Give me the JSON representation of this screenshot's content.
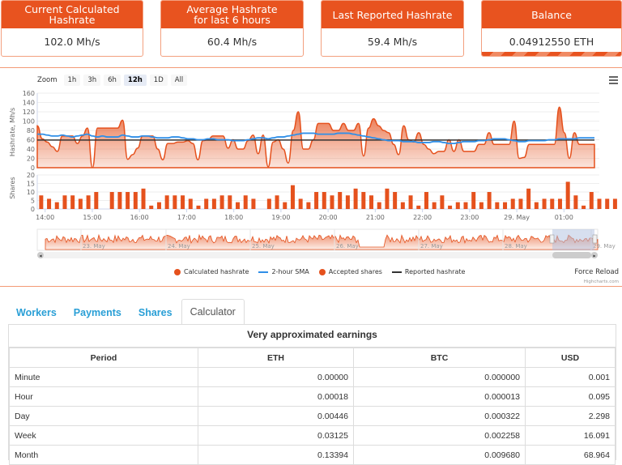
{
  "stats": [
    {
      "title": "Current Calculated Hashrate",
      "value": "102.0 Mh/s"
    },
    {
      "title": "Average Hashrate for last 6 hours",
      "value": "60.4 Mh/s"
    },
    {
      "title": "Last Reported Hashrate",
      "value": "59.4 Mh/s"
    },
    {
      "title": "Balance",
      "value": "0.04912550 ETH"
    }
  ],
  "zoom": {
    "label": "Zoom",
    "buttons": [
      "1h",
      "3h",
      "6h",
      "12h",
      "1D",
      "All"
    ],
    "active": "12h"
  },
  "legend": [
    {
      "label": "Calculated hashrate",
      "color": "#e5511d",
      "kind": "dot"
    },
    {
      "label": "2-hour SMA",
      "color": "#2f8fe8",
      "kind": "line"
    },
    {
      "label": "Accepted shares",
      "color": "#e5511d",
      "kind": "dot"
    },
    {
      "label": "Reported hashrate",
      "color": "#333333",
      "kind": "line"
    }
  ],
  "force_reload": "Force Reload",
  "credits": "Highcharts.com",
  "chart_data": {
    "type": "area",
    "hashrate": {
      "ylabel": "Hashrate, Mh/s",
      "ylim": [
        0,
        160
      ],
      "yticks": [
        0,
        20,
        40,
        60,
        80,
        100,
        120,
        140,
        160
      ],
      "calculated": [
        90,
        62,
        55,
        45,
        35,
        68,
        68,
        68,
        52,
        68,
        85,
        0,
        85,
        85,
        85,
        85,
        85,
        102,
        18,
        28,
        42,
        68,
        68,
        68,
        40,
        17,
        52,
        52,
        55,
        55,
        58,
        52,
        17,
        58,
        60,
        68,
        68,
        68,
        42,
        60,
        40,
        40,
        58,
        70,
        30,
        70,
        2,
        55,
        60,
        40,
        10,
        80,
        120,
        40,
        40,
        60,
        95,
        95,
        95,
        80,
        80,
        95,
        80,
        80,
        95,
        25,
        85,
        105,
        90,
        80,
        75,
        50,
        28,
        90,
        60,
        55,
        75,
        50,
        40,
        30,
        35,
        35,
        60,
        35,
        60,
        35,
        35,
        35,
        50,
        50,
        75,
        50,
        50,
        50,
        50,
        100,
        20,
        22,
        50,
        50,
        50,
        50,
        50,
        50,
        130,
        75,
        20,
        75,
        50,
        50,
        50,
        50
      ],
      "sma": [
        72,
        72,
        70,
        68,
        68,
        70,
        68,
        66,
        68,
        70,
        72,
        68,
        66,
        68,
        66,
        66,
        66,
        70,
        68,
        66,
        66,
        68,
        68,
        66,
        64,
        64,
        64,
        66,
        66,
        64,
        62,
        62,
        60,
        60,
        62,
        62,
        60,
        60,
        60,
        58,
        58,
        58,
        60,
        62,
        64,
        64,
        62,
        64,
        66,
        66,
        68,
        70,
        72,
        74,
        74,
        74,
        72,
        72,
        72,
        72,
        74,
        74,
        74,
        72,
        70,
        68,
        66,
        64,
        62,
        60,
        58,
        58,
        58,
        56,
        56,
        56,
        54,
        54,
        54,
        56,
        56,
        54,
        52,
        52,
        54,
        56,
        56,
        56,
        58,
        58,
        60,
        62,
        62,
        62,
        60,
        58,
        56,
        56,
        58,
        58,
        58,
        58,
        60,
        60,
        62,
        62,
        62,
        62,
        64,
        64,
        64,
        64
      ],
      "reported": 59.4
    },
    "shares": {
      "ylabel": "Shares",
      "ylim": [
        0,
        20
      ],
      "yticks": [
        0,
        5,
        10,
        15,
        20
      ],
      "values": [
        8,
        6,
        4,
        8,
        8,
        6,
        8,
        10,
        0,
        10,
        10,
        10,
        10,
        12,
        2,
        4,
        8,
        8,
        8,
        6,
        2,
        6,
        6,
        8,
        8,
        4,
        8,
        6,
        0,
        6,
        8,
        4,
        14,
        6,
        4,
        10,
        10,
        8,
        10,
        8,
        12,
        10,
        8,
        4,
        12,
        10,
        4,
        8,
        2,
        10,
        4,
        8,
        2,
        4,
        4,
        10,
        4,
        10,
        4,
        4,
        6,
        6,
        12,
        4,
        6,
        6,
        6,
        16,
        8,
        2,
        10,
        6,
        6,
        6
      ]
    },
    "x_start": "13:50",
    "x_end": "01:45",
    "interval_minutes": 10,
    "xticks": [
      "14:00",
      "15:00",
      "16:00",
      "17:00",
      "18:00",
      "19:00",
      "20:00",
      "21:00",
      "22:00",
      "23:00",
      "29. May",
      "01:00"
    ],
    "navigator": {
      "labels": [
        "23. May",
        "24. May",
        "25. May",
        "26. May",
        "27. May",
        "28. May",
        "29. May"
      ]
    }
  },
  "tabs": [
    {
      "label": "Workers"
    },
    {
      "label": "Payments"
    },
    {
      "label": "Shares"
    },
    {
      "label": "Calculator"
    }
  ],
  "active_tab": "Calculator",
  "calculator": {
    "title": "Very approximated earnings",
    "columns": [
      "Period",
      "ETH",
      "BTC",
      "USD"
    ],
    "rows": [
      [
        "Minute",
        "0.00000",
        "0.000000",
        "0.001"
      ],
      [
        "Hour",
        "0.00018",
        "0.000013",
        "0.095"
      ],
      [
        "Day",
        "0.00446",
        "0.000322",
        "2.298"
      ],
      [
        "Week",
        "0.03125",
        "0.002258",
        "16.091"
      ],
      [
        "Month",
        "0.13394",
        "0.009680",
        "68.964"
      ]
    ]
  }
}
